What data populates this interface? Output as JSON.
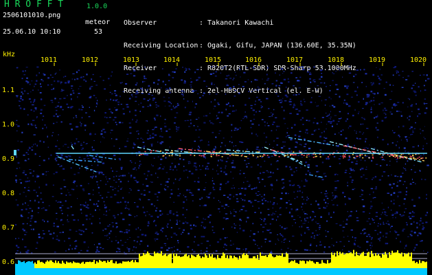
{
  "header": {
    "app_title": "H R O F F T",
    "app_version": "1.0.0",
    "filename": "2506101010.png",
    "datetime": "25.06.10 10:10",
    "mode": "meteor",
    "count": "53"
  },
  "station": {
    "labels": [
      "Observer",
      "Receiving Location",
      "Receiver",
      "Receiving antenna"
    ],
    "values": [
      ": Takanori Kawachi",
      ": Ogaki, Gifu, JAPAN (136.60E, 35.35N)",
      ": R820T2(RTL-SDR) SDR-Sharp 53.1000MHz",
      ": 2el-HB9CV Vertical (el. E-W)"
    ]
  },
  "axes": {
    "y_unit": "kHz",
    "x_ticks": [
      "1011",
      "1012",
      "1013",
      "1014",
      "1015",
      "1016",
      "1017",
      "1018",
      "1019",
      "1020"
    ],
    "y_ticks": [
      "1.1",
      "1.0",
      "0.9",
      "0.8",
      "0.7",
      "0.6"
    ]
  },
  "colors": {
    "label_green": "#19d95a",
    "axis_yellow": "#fff200",
    "carrier_cyan": "#5fd8ff",
    "noise_blue": "#1a2a9a",
    "level_yellow": "#ffff00",
    "level_cyan": "#00c8ff"
  }
}
